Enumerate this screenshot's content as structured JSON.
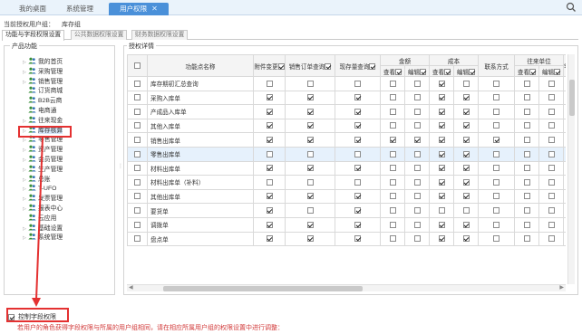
{
  "top_tabs": [
    {
      "label": "我的桌面",
      "active": false
    },
    {
      "label": "系统管理",
      "active": false
    },
    {
      "label": "用户权限",
      "active": true
    }
  ],
  "user_line": {
    "label": "当前授权用户组：",
    "value": "库存组"
  },
  "sub_tabs": [
    {
      "label": "功能与字段权限设置",
      "active": true
    },
    {
      "label": "公共数据权限设置",
      "active": false
    },
    {
      "label": "财务数据权限设置",
      "active": false
    }
  ],
  "left_panel": {
    "title": "产品功能",
    "items": [
      {
        "label": "我的首页",
        "arrow": true
      },
      {
        "label": "采购管理",
        "arrow": true
      },
      {
        "label": "销售管理",
        "arrow": true
      },
      {
        "label": "订货商城",
        "arrow": false
      },
      {
        "label": "B2B云商",
        "arrow": false
      },
      {
        "label": "电商通",
        "arrow": false
      },
      {
        "label": "往来现金",
        "arrow": true
      },
      {
        "label": "库存核算",
        "arrow": true,
        "selected": true
      },
      {
        "label": "零售管理",
        "arrow": true
      },
      {
        "label": "资产管理",
        "arrow": true
      },
      {
        "label": "会员管理",
        "arrow": true
      },
      {
        "label": "生产管理",
        "arrow": true
      },
      {
        "label": "总账",
        "arrow": true
      },
      {
        "label": "T-UFO",
        "arrow": true
      },
      {
        "label": "发票管理",
        "arrow": true
      },
      {
        "label": "报表中心",
        "arrow": true
      },
      {
        "label": "云应用",
        "arrow": false
      },
      {
        "label": "基础设置",
        "arrow": true
      },
      {
        "label": "系统管理",
        "arrow": true
      }
    ]
  },
  "right_panel": {
    "title": "授权详情",
    "columns": {
      "name": "功能点名称",
      "attachment": "附件变更",
      "sales_query": "销售订单查询",
      "stock_query": "现存量查询",
      "amount": "金额",
      "cost": "成本",
      "contact": "联系方式",
      "partner": "往来单位",
      "extra": "零",
      "view": "查看",
      "edit": "编辑"
    },
    "rows": [
      {
        "name": "库存期初汇总查询",
        "att": false,
        "sales": false,
        "stock": false,
        "amt_v": false,
        "amt_e": false,
        "cost_v": true,
        "cost_e": false,
        "contact": false,
        "partner": false
      },
      {
        "name": "采购入库单",
        "att": true,
        "sales": true,
        "stock": true,
        "amt_v": false,
        "amt_e": false,
        "cost_v": true,
        "cost_e": true,
        "contact": false,
        "partner": false
      },
      {
        "name": "产成品入库单",
        "att": true,
        "sales": true,
        "stock": true,
        "amt_v": false,
        "amt_e": false,
        "cost_v": true,
        "cost_e": true,
        "contact": false,
        "partner": false
      },
      {
        "name": "其他入库单",
        "att": true,
        "sales": true,
        "stock": true,
        "amt_v": false,
        "amt_e": false,
        "cost_v": true,
        "cost_e": true,
        "contact": false,
        "partner": false
      },
      {
        "name": "销售出库单",
        "att": true,
        "sales": true,
        "stock": true,
        "amt_v": true,
        "amt_e": true,
        "cost_v": true,
        "cost_e": true,
        "contact": true,
        "partner": false
      },
      {
        "name": "零售出库单",
        "att": false,
        "sales": false,
        "stock": false,
        "amt_v": false,
        "amt_e": false,
        "cost_v": true,
        "cost_e": true,
        "contact": false,
        "partner": false,
        "selected": true
      },
      {
        "name": "材料出库单",
        "att": true,
        "sales": true,
        "stock": true,
        "amt_v": false,
        "amt_e": false,
        "cost_v": true,
        "cost_e": true,
        "contact": false,
        "partner": false
      },
      {
        "name": "材料出库单（补料）",
        "att": false,
        "sales": false,
        "stock": false,
        "amt_v": false,
        "amt_e": false,
        "cost_v": true,
        "cost_e": true,
        "contact": false,
        "partner": false
      },
      {
        "name": "其他出库单",
        "att": true,
        "sales": true,
        "stock": true,
        "amt_v": false,
        "amt_e": false,
        "cost_v": true,
        "cost_e": true,
        "contact": false,
        "partner": false
      },
      {
        "name": "要货单",
        "att": true,
        "sales": false,
        "stock": true,
        "amt_v": false,
        "amt_e": false,
        "cost_v": false,
        "cost_e": false,
        "contact": false,
        "partner": false
      },
      {
        "name": "调拨单",
        "att": true,
        "sales": true,
        "stock": true,
        "amt_v": false,
        "amt_e": false,
        "cost_v": true,
        "cost_e": true,
        "contact": false,
        "partner": false
      },
      {
        "name": "盘点单",
        "att": true,
        "sales": true,
        "stock": true,
        "amt_v": false,
        "amt_e": false,
        "cost_v": true,
        "cost_e": true,
        "contact": false,
        "partner": false
      }
    ]
  },
  "control_field": {
    "label": "控制字段权限",
    "checked": true
  },
  "hint": "若用户的角色获得字段权限与所属的用户组相同，请在相应所属用户组的权限设置中进行调整：",
  "colors": {
    "accent": "#4a90d9",
    "annotation": "#e43131",
    "hint": "#d23b3b"
  }
}
